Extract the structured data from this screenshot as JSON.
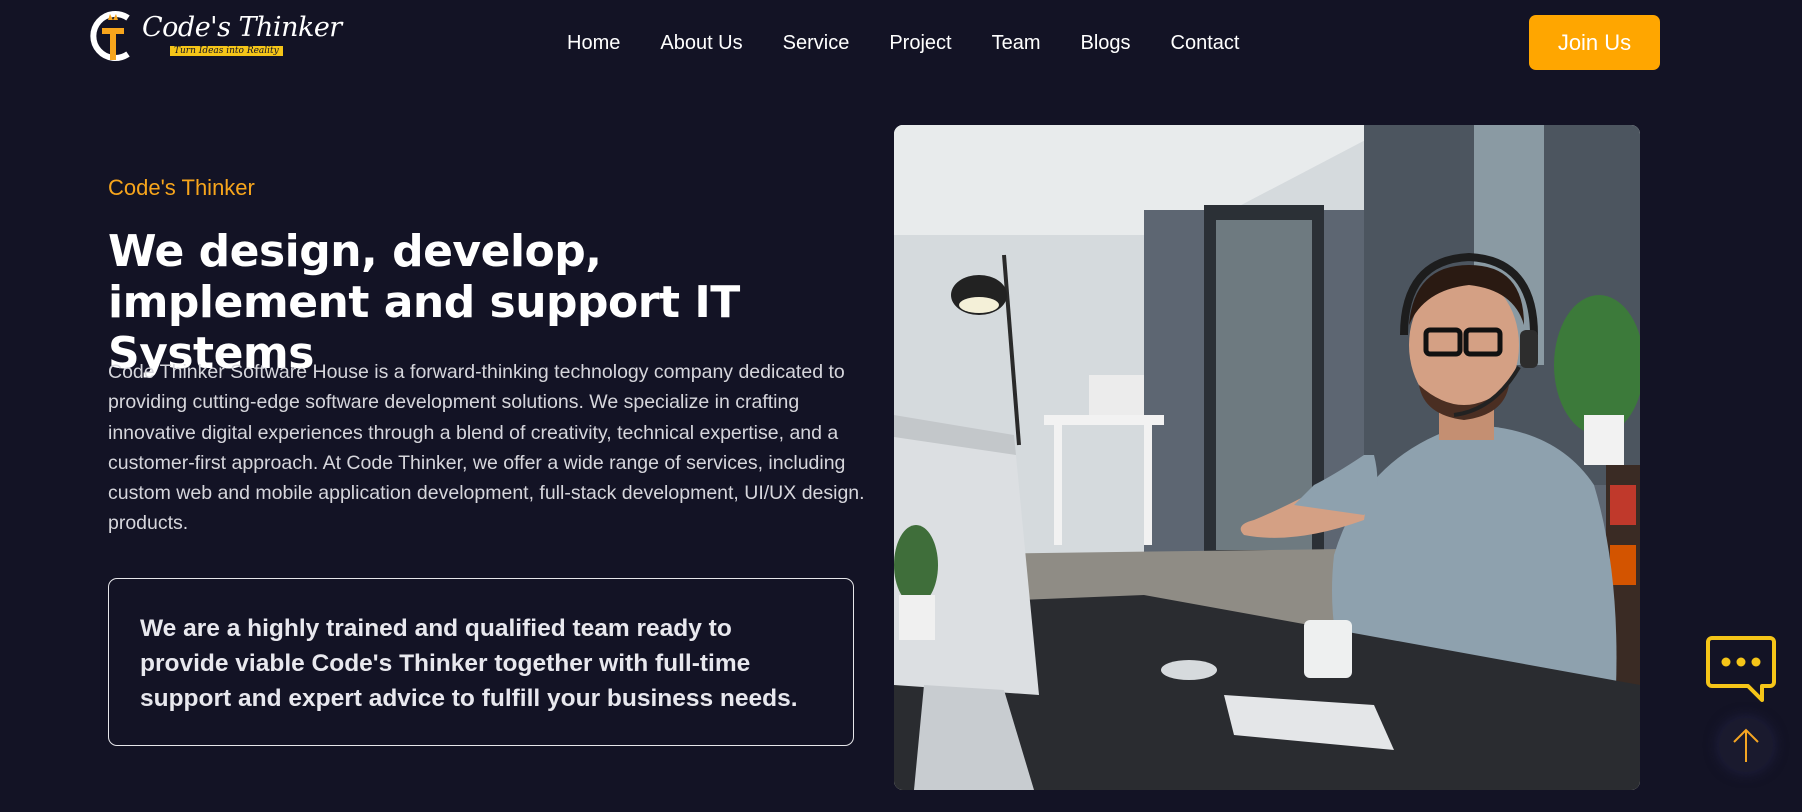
{
  "brand": {
    "name": "Code's Thinker",
    "tagline": "Turn Ideas into Reality",
    "accent_color": "#ffa600",
    "background_color": "#131325"
  },
  "nav": {
    "items": [
      {
        "label": "Home"
      },
      {
        "label": "About Us"
      },
      {
        "label": "Service"
      },
      {
        "label": "Project"
      },
      {
        "label": "Team"
      },
      {
        "label": "Blogs"
      },
      {
        "label": "Contact"
      }
    ],
    "cta_label": "Join Us"
  },
  "hero": {
    "eyebrow": "Code's Thinker",
    "headline": "We design, develop, implement and support IT Systems",
    "description": "Code Thinker Software House is a forward-thinking technology company dedicated to providing cutting-edge software development solutions. We specialize in crafting innovative digital experiences through a blend of creativity, technical expertise, and a customer-first approach. At Code Thinker, we offer a wide range of services, including custom web and mobile application development, full-stack development, UI/UX design. products.",
    "callout": "We are a highly trained and qualified team ready to provide viable Code's Thinker together with full-time support and expert advice to fulfill your business needs.",
    "image_icon": "photo-man-with-headset-at-computer"
  },
  "floating": {
    "chat_icon": "chat-bubble-icon",
    "scroll_icon": "arrow-up-icon"
  }
}
